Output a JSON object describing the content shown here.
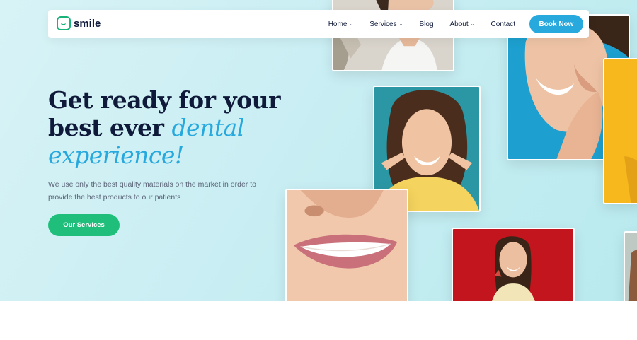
{
  "brand": {
    "name": "smile",
    "color": "#19b37a"
  },
  "nav": {
    "items": [
      {
        "label": "Home",
        "dropdown": true
      },
      {
        "label": "Services",
        "dropdown": true
      },
      {
        "label": "Blog",
        "dropdown": false
      },
      {
        "label": "About",
        "dropdown": true
      },
      {
        "label": "Contact",
        "dropdown": false
      }
    ],
    "chevron": "⌄",
    "book_label": "Book Now",
    "book_color": "#28a9de"
  },
  "hero": {
    "line1": "Get ready for your",
    "line2": "best ever",
    "accent1": "dental",
    "accent2": "experience!",
    "description": "We use only the best quality materials on the market in order to provide the best products to our patients",
    "cta_label": "Our Services",
    "cta_color": "#1fbf7b",
    "headline_color": "#0f1a3a",
    "accent_color": "#28a9de"
  },
  "photos": [
    {
      "name": "woman-smiling-pampas-photo"
    },
    {
      "name": "woman-touching-cheek-photo"
    },
    {
      "name": "woman-pointing-smile-photo"
    },
    {
      "name": "yellow-tile-photo"
    },
    {
      "name": "closeup-smile-photo"
    },
    {
      "name": "woman-red-background-photo"
    },
    {
      "name": "edge-partial-photo"
    }
  ]
}
